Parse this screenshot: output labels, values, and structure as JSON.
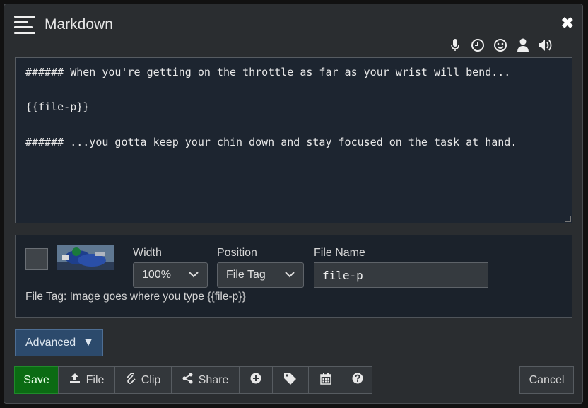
{
  "header": {
    "title": "Markdown",
    "close_glyph": "✖"
  },
  "tool_icons": [
    "microphone-icon",
    "clock-icon",
    "smiley-icon",
    "user-icon",
    "volume-icon"
  ],
  "editor": {
    "content": "###### When you're getting on the throttle as far as your wrist will bend...\n\n{{file-p}}\n\n###### ...you gotta keep your chin down and stay focused on the task at hand."
  },
  "file": {
    "width_label": "Width",
    "width_value": "100%",
    "position_label": "Position",
    "position_value": "File Tag",
    "filename_label": "File Name",
    "filename_value": "file-p",
    "hint": "File Tag: Image goes where you type {{file-p}}"
  },
  "advanced": {
    "label": "Advanced",
    "arrow": "▼"
  },
  "toolbar": {
    "save": "Save",
    "file": "File",
    "clip": "Clip",
    "share": "Share",
    "cancel": "Cancel"
  },
  "colors": {
    "save": "#0b6b13",
    "advanced": "#2c4a6c",
    "editor_bg": "#1d2530"
  }
}
